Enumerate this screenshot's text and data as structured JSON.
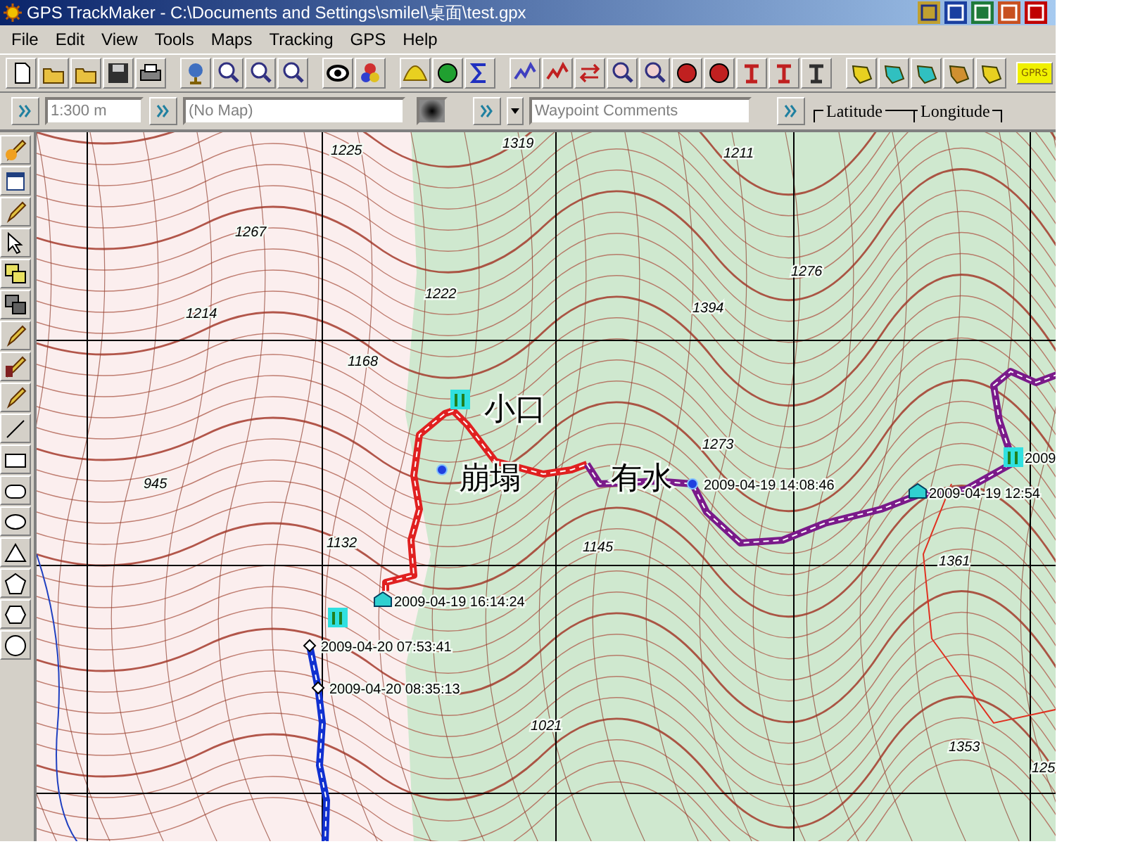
{
  "window": {
    "title": "GPS TrackMaker - C:\\Documents and Settings\\smilel\\桌面\\test.gpx"
  },
  "menu": [
    "File",
    "Edit",
    "View",
    "Tools",
    "Maps",
    "Tracking",
    "GPS",
    "Help"
  ],
  "toolbar": {
    "gprs_label": "GPRS"
  },
  "field_bar": {
    "scale": "1:300 m",
    "map": "(No Map)",
    "comments_placeholder": "Waypoint Comments",
    "latitude_label": "Latitude",
    "longitude_label": "Longitude"
  },
  "map": {
    "elevations": [
      "1225",
      "1319",
      "1211",
      "1267",
      "1214",
      "1222",
      "1276",
      "1394",
      "1168",
      "945",
      "1132",
      "1273",
      "1145",
      "1361",
      "1353",
      "1021",
      "125"
    ],
    "place_labels": [
      "小口",
      "崩塌",
      "有水"
    ],
    "waypoints": [
      {
        "kind": "flag"
      },
      {
        "kind": "dot"
      },
      {
        "kind": "dot",
        "label": "2009-04-19 14:08:46"
      },
      {
        "kind": "house",
        "label": "2009-04-19 12:54"
      },
      {
        "kind": "flag",
        "label": "2009"
      },
      {
        "kind": "house",
        "label": "2009-04-19 16:14:24"
      },
      {
        "kind": "flag"
      },
      {
        "kind": "diamond",
        "label": "2009-04-20 07:53:41"
      },
      {
        "kind": "diamond",
        "label": "2009-04-20 08:35:13"
      }
    ]
  }
}
